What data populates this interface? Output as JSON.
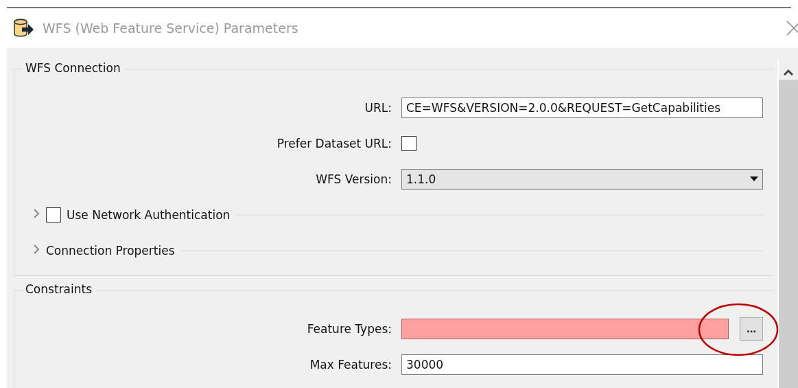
{
  "window": {
    "title": "WFS (Web Feature Service) Parameters"
  },
  "connection": {
    "title": "WFS Connection",
    "rows": [
      {
        "kind": "text",
        "label": "URL:",
        "value": "CE=WFS&VERSION=2.0.0&REQUEST=GetCapabilities"
      },
      {
        "kind": "checkbox",
        "label": "Prefer Dataset URL:",
        "checked": false
      },
      {
        "kind": "dropdown",
        "label": "WFS Version:",
        "value": "1.1.0"
      }
    ],
    "sections": [
      {
        "label": "Use Network Authentication",
        "checked": false,
        "expanded": false
      },
      {
        "label": "Connection Properties",
        "expanded": false
      }
    ]
  },
  "constraints": {
    "title": "Constraints",
    "rows": [
      {
        "kind": "browse",
        "label": "Feature Types:",
        "value": "",
        "error": true,
        "button": "...",
        "highlighted": true
      },
      {
        "kind": "text",
        "label": "Max Features:",
        "value": "30000"
      }
    ]
  }
}
